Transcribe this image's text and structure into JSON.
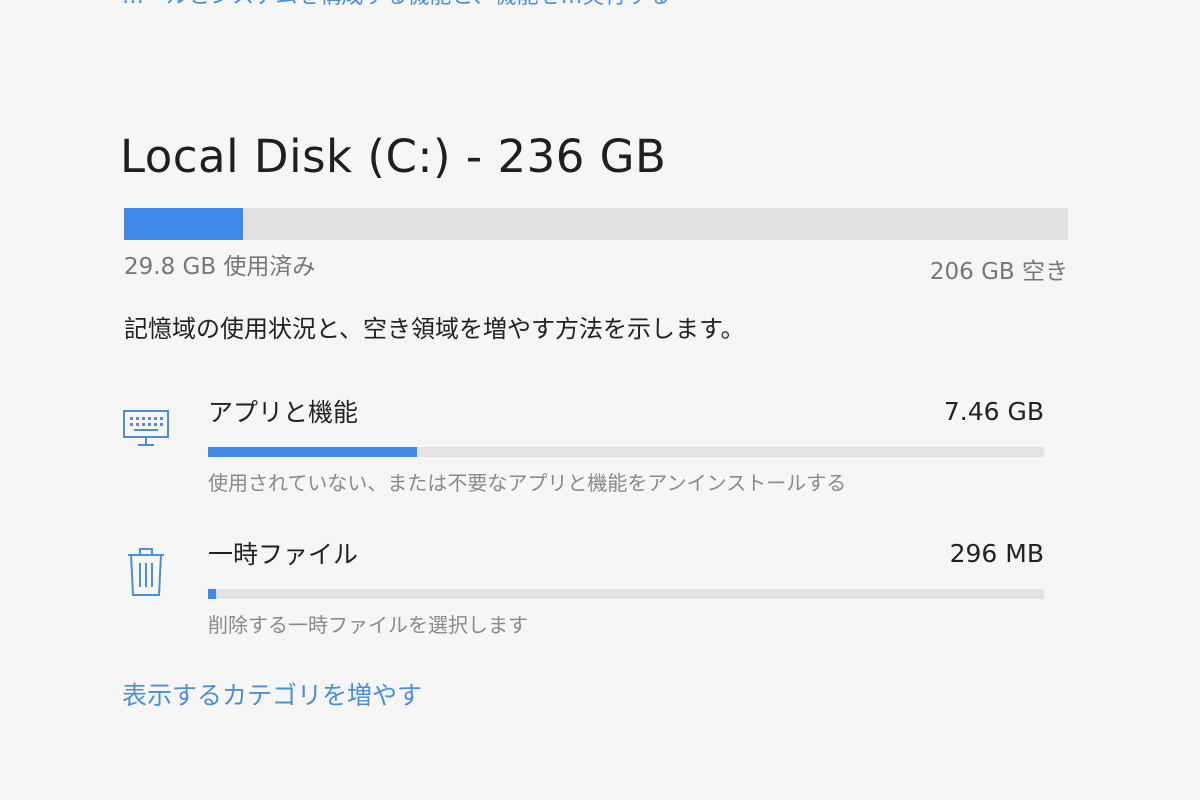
{
  "top_link": {
    "label": "…ールとシステムを構成する機能と、機能を…実行する"
  },
  "disk": {
    "title": "Local Disk (C:) - 236 GB",
    "used_label": "29.8 GB 使用済み",
    "free_label": "206 GB 空き",
    "used_fraction": 0.126,
    "accent_color": "#3f8ae8"
  },
  "description": "記憶域の使用状況と、空き領域を増やす方法を示します。",
  "categories": [
    {
      "name": "アプリと機能",
      "size": "7.46 GB",
      "description": "使用されていない、または不要なアプリと機能をアンインストールする",
      "fraction": 0.25,
      "icon": "apps-keyboard-monitor-icon"
    },
    {
      "name": "一時ファイル",
      "size": "296 MB",
      "description": "削除する一時ファイルを選択します",
      "fraction": 0.01,
      "icon": "trash-icon"
    }
  ],
  "more_link": {
    "label": "表示するカテゴリを増やす"
  }
}
